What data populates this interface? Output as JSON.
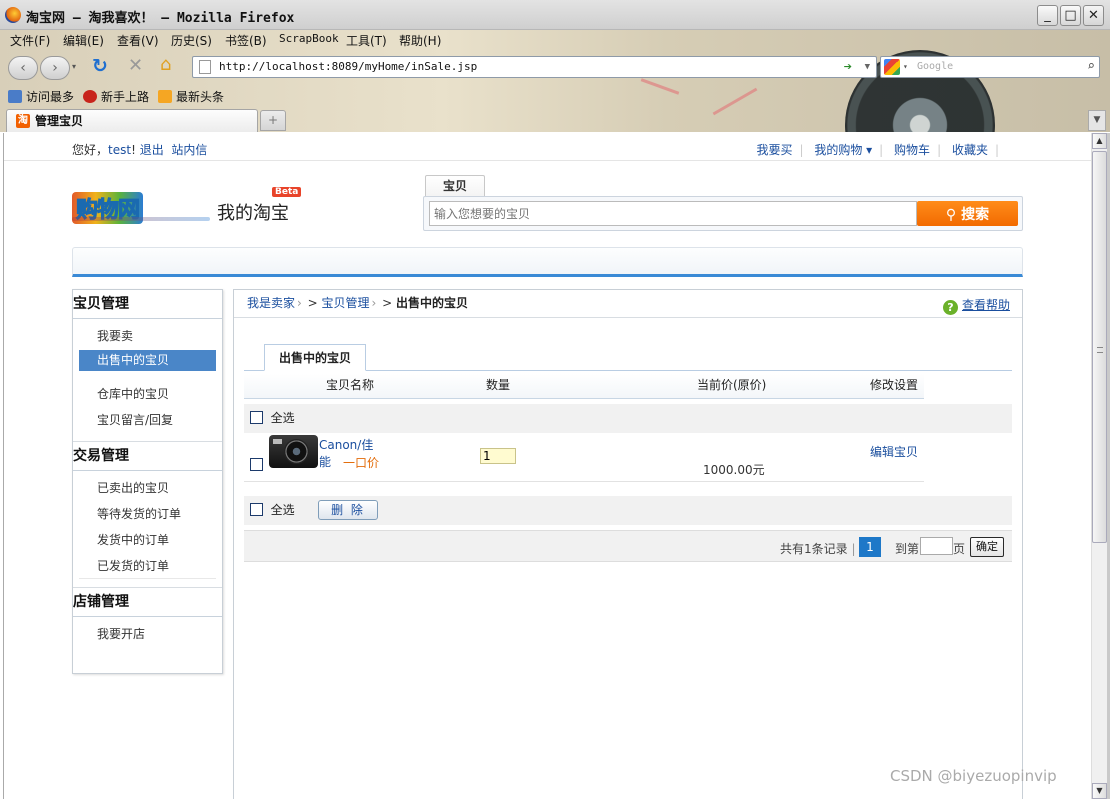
{
  "window": {
    "title": "淘宝网 – 淘我喜欢！ – Mozilla Firefox",
    "min": "_",
    "max": "□",
    "close": "✕"
  },
  "menu": [
    "文件(F)",
    "编辑(E)",
    "查看(V)",
    "历史(S)",
    "书签(B)",
    "ScrapBook",
    "工具(T)",
    "帮助(H)"
  ],
  "nav": {
    "url": "http://localhost:8089/myHome/inSale.jsp",
    "search_placeholder": "Google"
  },
  "bookmarks": [
    "访问最多",
    "新手上路",
    "最新头条"
  ],
  "tab": {
    "label": "管理宝贝",
    "icon_text": "淘"
  },
  "topbar": {
    "greeting_prefix": "您好，",
    "user": "test",
    "greeting_suffix": "!",
    "logout": "退出",
    "messages": "站内信",
    "links": [
      "我要买",
      "我的购物 ▾",
      "购物车",
      "收藏夹"
    ]
  },
  "header": {
    "logo_text": "购物网",
    "site_sub": "我的淘宝",
    "beta": "Beta",
    "search_tab": "宝贝",
    "search_placeholder": "输入您想要的宝贝",
    "search_button": "搜索"
  },
  "sidebar": {
    "groups": [
      {
        "title": "宝贝管理",
        "items": [
          "我要卖",
          "出售中的宝贝",
          "仓库中的宝贝",
          "宝贝留言/回复"
        ]
      },
      {
        "title": "交易管理",
        "items": [
          "已卖出的宝贝",
          "等待发货的订单",
          "发货中的订单",
          "已发货的订单"
        ]
      },
      {
        "title": "店铺管理",
        "items": [
          "我要开店"
        ]
      }
    ],
    "active": "出售中的宝贝"
  },
  "breadcrumb": {
    "root": "我是卖家",
    "mid": "宝贝管理",
    "current": "出售中的宝贝",
    "help": "查看帮助"
  },
  "list": {
    "tab": "出售中的宝贝",
    "columns": [
      "宝贝名称",
      "数量",
      "当前价(原价)",
      "修改设置"
    ],
    "select_all": "全选",
    "delete": "删 除",
    "rows": [
      {
        "name_line1": "Canon/佳",
        "name_line2": "能",
        "price_type": "一口价",
        "qty": "1",
        "price": "1000.00元",
        "edit": "编辑宝贝"
      }
    ]
  },
  "pager": {
    "info": "共有1条记录",
    "sep": "|",
    "page": "1",
    "goto": "到第",
    "unit": "页",
    "ok": "确定"
  },
  "watermark": "CSDN @biyezuopinvip"
}
